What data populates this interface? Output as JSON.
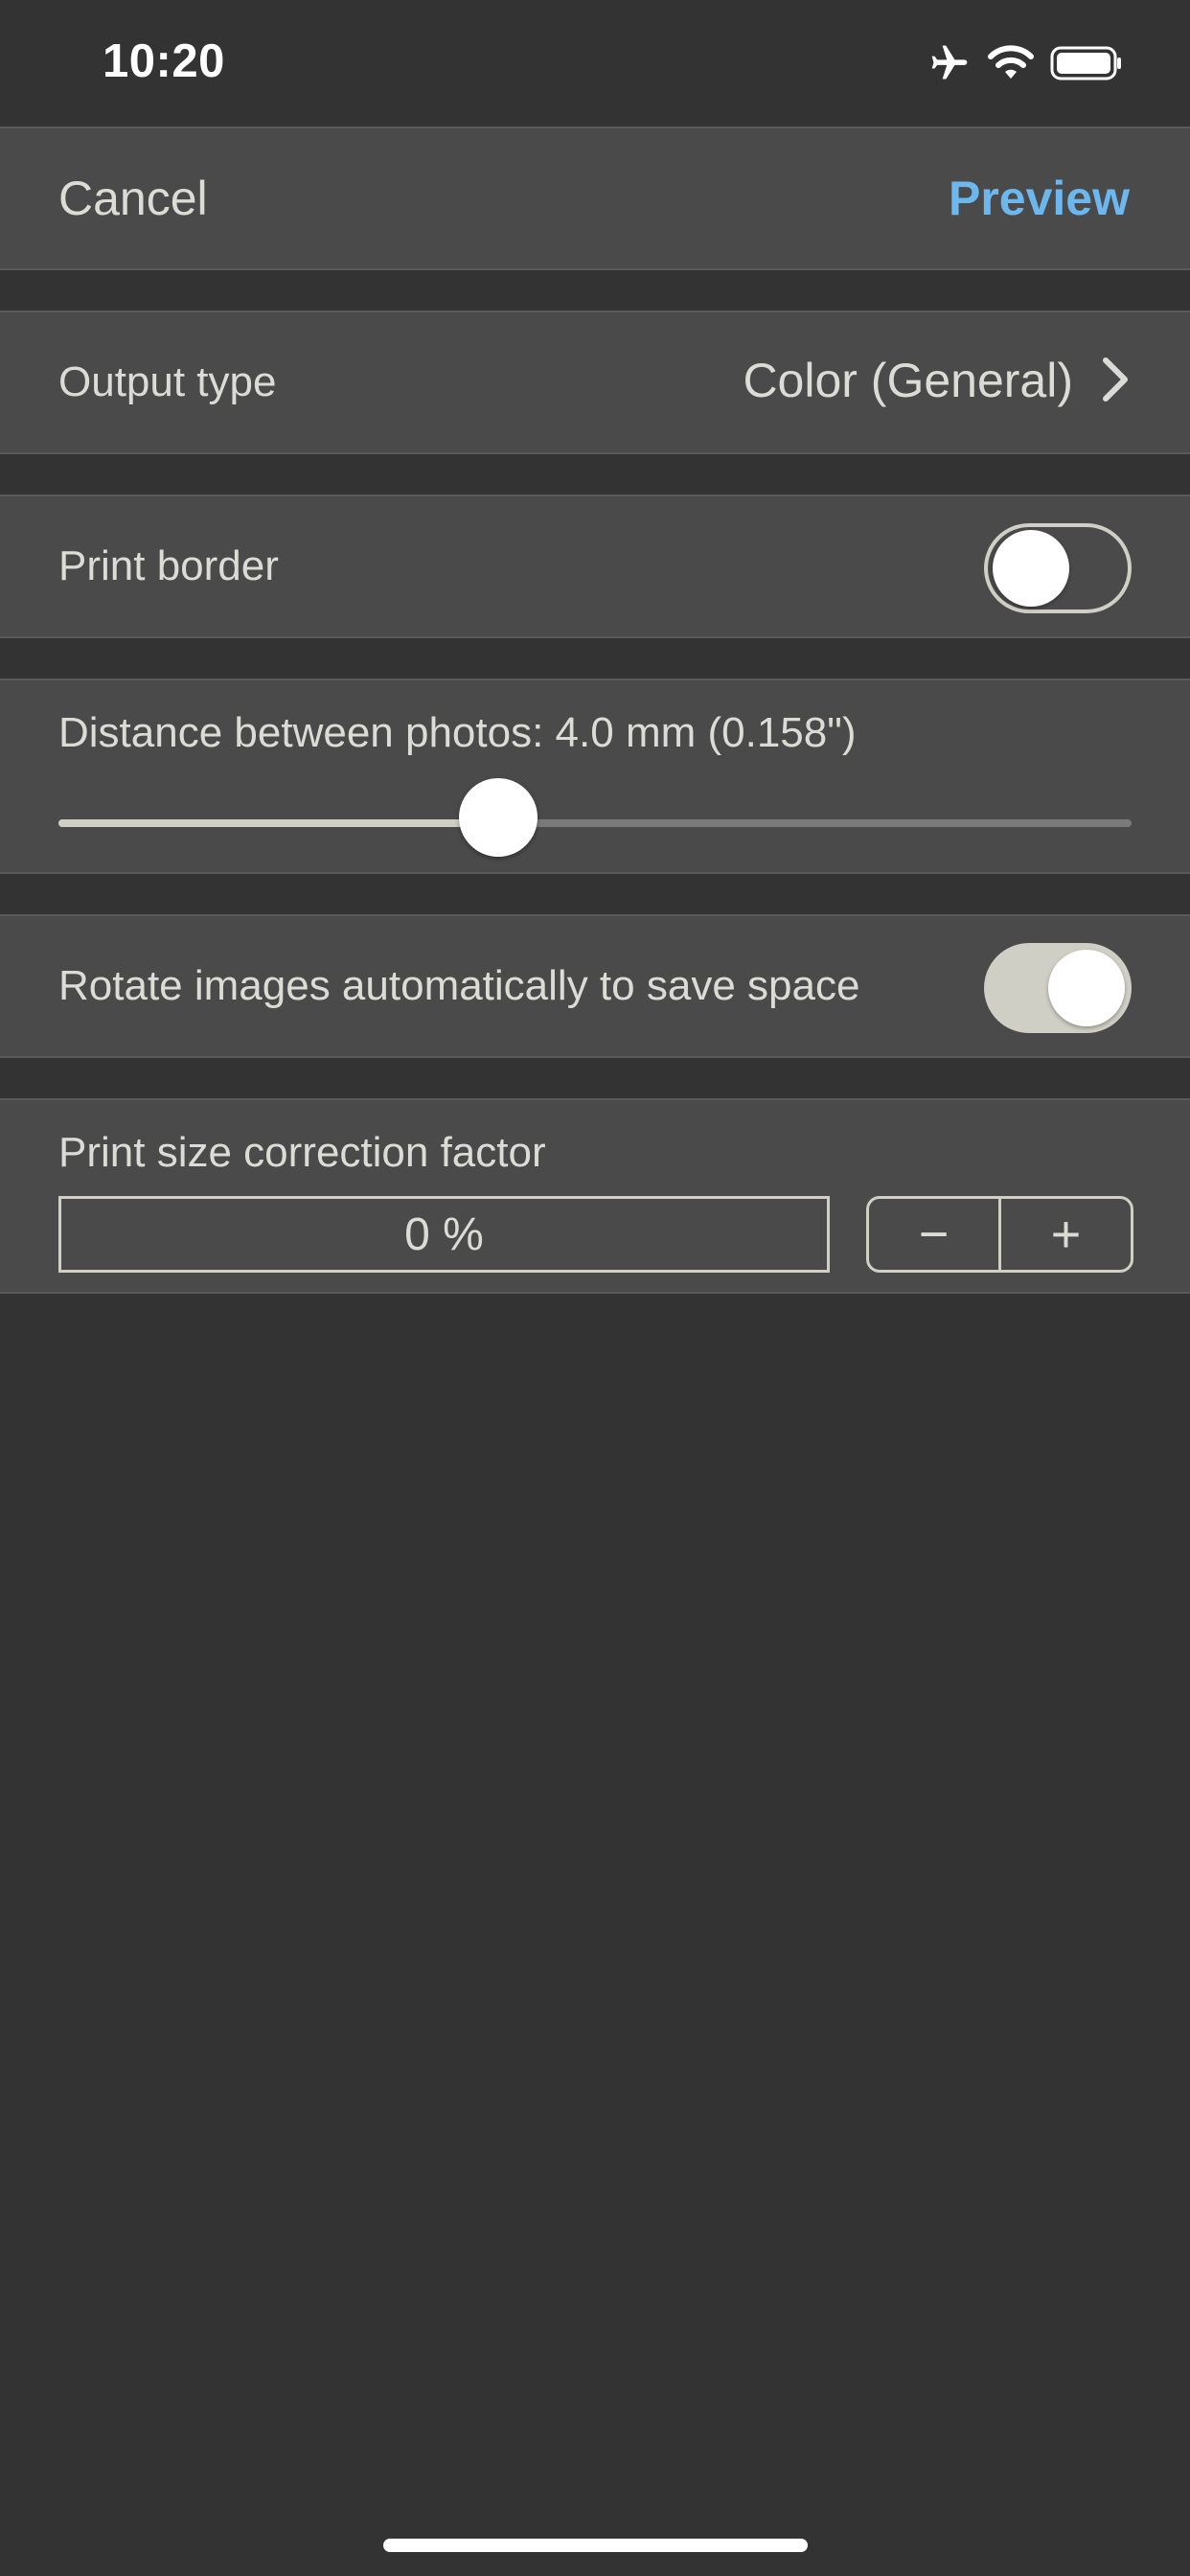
{
  "status_bar": {
    "time": "10:20",
    "icons": [
      "airplane-icon",
      "wifi-icon",
      "battery-icon"
    ]
  },
  "nav": {
    "cancel_label": "Cancel",
    "preview_label": "Preview",
    "preview_color": "#6cb8ee"
  },
  "settings": {
    "output_type": {
      "label": "Output type",
      "value": "Color (General)"
    },
    "print_border": {
      "label": "Print border",
      "enabled": false
    },
    "distance": {
      "label": "Distance between photos: 4.0 mm (0.158\")",
      "slider_fraction": 0.41
    },
    "rotate_images": {
      "label": "Rotate images automatically to save space",
      "enabled": true
    },
    "correction_factor": {
      "label": "Print size correction factor",
      "value": "0 %",
      "minus_label": "−",
      "plus_label": "+"
    }
  }
}
